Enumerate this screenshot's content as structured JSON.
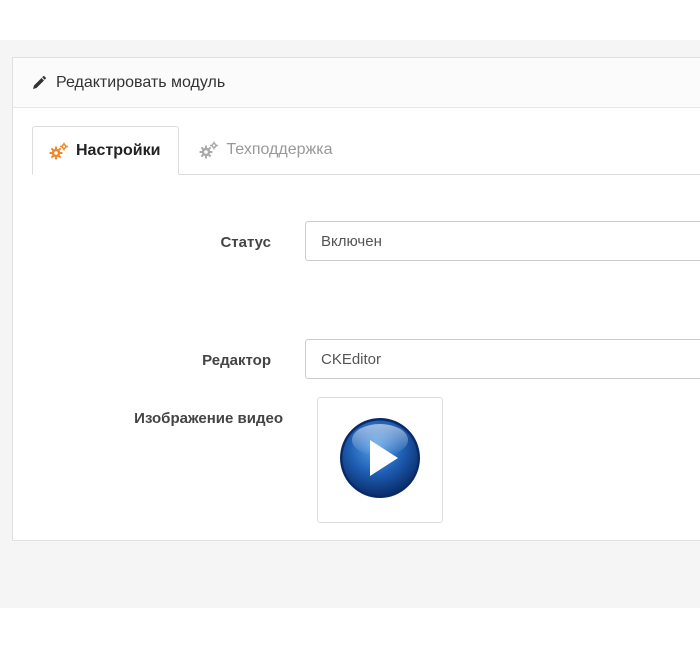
{
  "panel": {
    "title": "Редактировать модуль",
    "title_icon": "pencil-icon"
  },
  "tabs": [
    {
      "label": "Настройки",
      "icon": "gears-icon",
      "active": true
    },
    {
      "label": "Техподдержка",
      "icon": "gears-icon",
      "active": false
    }
  ],
  "form": {
    "status": {
      "label": "Статус",
      "value": "Включен"
    },
    "editor": {
      "label": "Редактор",
      "value": "CKEditor"
    },
    "video_image": {
      "label": "Изображение видео",
      "icon": "play-button-icon"
    }
  },
  "colors": {
    "active_tab_icon": "#f0882d",
    "inactive_tab_icon": "#aaaaaa",
    "play_button": "#1e5fb4"
  }
}
